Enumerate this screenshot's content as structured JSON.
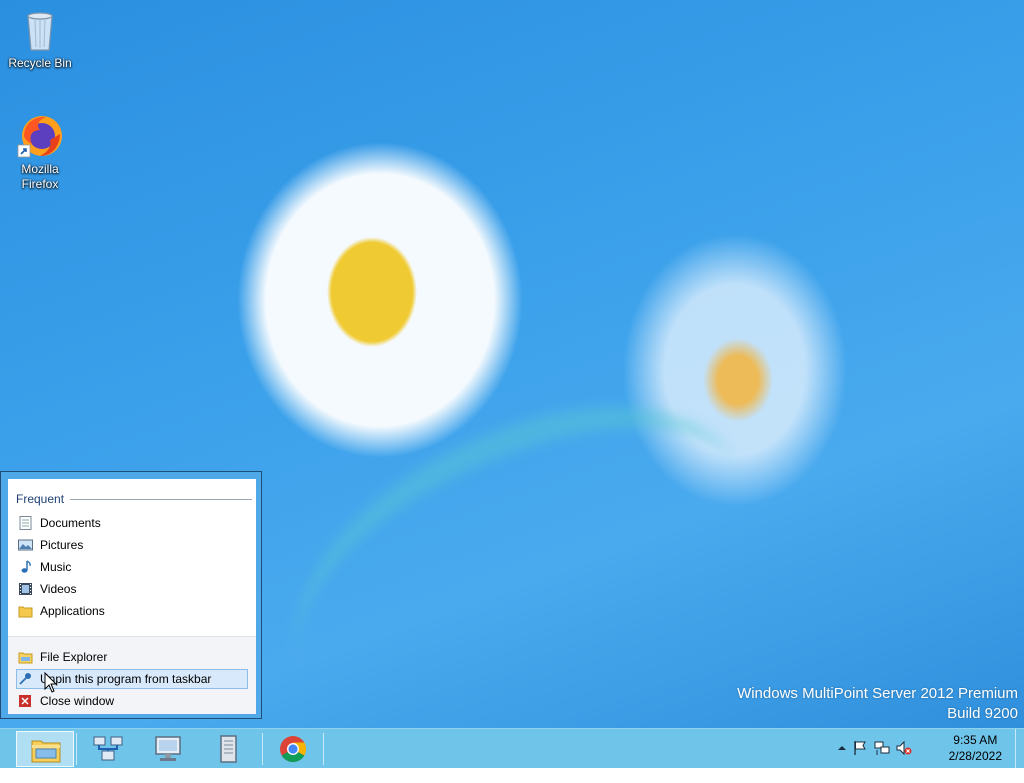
{
  "desktop": {
    "icons": [
      {
        "label": "Recycle Bin",
        "icon": "recycle-bin-icon"
      },
      {
        "label": "Mozilla Firefox",
        "line1": "Mozilla",
        "line2": "Firefox",
        "icon": "firefox-icon"
      }
    ],
    "watermark": {
      "line1": "Windows MultiPoint Server 2012 Premium",
      "line2": "Build 9200"
    }
  },
  "jumplist": {
    "header": "Frequent",
    "frequent": [
      {
        "label": "Documents",
        "icon": "documents-library-icon"
      },
      {
        "label": "Pictures",
        "icon": "pictures-library-icon"
      },
      {
        "label": "Music",
        "icon": "music-library-icon"
      },
      {
        "label": "Videos",
        "icon": "videos-library-icon"
      },
      {
        "label": "Applications",
        "icon": "folder-icon"
      }
    ],
    "tasks": [
      {
        "label": "File Explorer",
        "icon": "file-explorer-icon"
      },
      {
        "label": "Unpin this program from taskbar",
        "icon": "unpin-icon",
        "highlighted": true
      },
      {
        "label": "Close window",
        "icon": "close-icon"
      }
    ]
  },
  "taskbar": {
    "buttons": [
      {
        "name": "File Explorer",
        "icon": "file-explorer-icon",
        "active": true
      },
      {
        "name": "Network",
        "icon": "network-computers-icon"
      },
      {
        "name": "MultiPoint Dashboard",
        "icon": "monitor-icon"
      },
      {
        "name": "Document",
        "icon": "document-icon"
      },
      {
        "name": "Google Chrome",
        "icon": "chrome-icon"
      }
    ],
    "tray": {
      "icons": [
        "show-hidden-icons-arrow",
        "action-center-flag-icon",
        "network-icon",
        "volume-muted-icon"
      ],
      "time": "9:35 AM",
      "date": "2/28/2022"
    }
  },
  "colors": {
    "desktop_blue": "#3aa0ea",
    "taskbar": "#6fc4ea",
    "jumplist_frame": "#4fa9e8",
    "highlight": "#d8e9fb"
  }
}
